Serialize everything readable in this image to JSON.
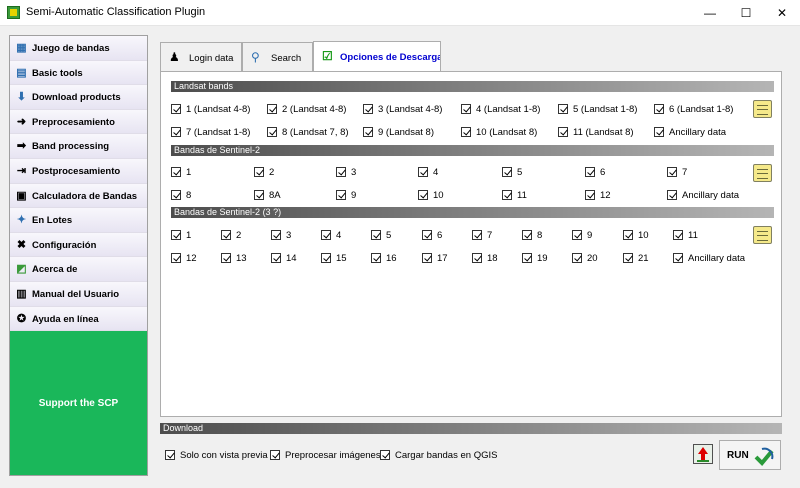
{
  "window": {
    "title": "Semi-Automatic Classification Plugin",
    "minimize": "—",
    "maximize": "☐",
    "close": "✕"
  },
  "sidebar": {
    "items": [
      {
        "label": "Juego de bandas",
        "icon": "band-set-icon"
      },
      {
        "label": "Basic tools",
        "icon": "basic-tools-icon"
      },
      {
        "label": "Download products",
        "icon": "download-icon"
      },
      {
        "label": "Preprocesamiento",
        "icon": "preprocessing-icon"
      },
      {
        "label": "Band processing",
        "icon": "band-processing-icon"
      },
      {
        "label": "Postprocesamiento",
        "icon": "postprocessing-icon"
      },
      {
        "label": "Calculadora de Bandas",
        "icon": "calculator-icon"
      },
      {
        "label": "En Lotes",
        "icon": "batch-icon"
      },
      {
        "label": "Configuración",
        "icon": "settings-icon"
      },
      {
        "label": "Acerca de",
        "icon": "about-icon"
      },
      {
        "label": "Manual del Usuario",
        "icon": "manual-icon"
      },
      {
        "label": "Ayuda en línea",
        "icon": "help-icon"
      }
    ],
    "support": "Support the SCP"
  },
  "tabs": [
    {
      "label": "Login data",
      "icon": "user-icon"
    },
    {
      "label": "Search",
      "icon": "search-icon"
    },
    {
      "label": "Opciones de Descarga",
      "icon": "checkbox-icon"
    }
  ],
  "landsat": {
    "header": "Landsat bands",
    "items": [
      "1 (Landsat 4-8)",
      "2 (Landsat 4-8)",
      "3 (Landsat 4-8)",
      "4 (Landsat 1-8)",
      "5 (Landsat 1-8)",
      "6 (Landsat 1-8)",
      "7 (Landsat 1-8)",
      "8 (Landsat 7, 8)",
      "9 (Landsat 8)",
      "10 (Landsat 8)",
      "11 (Landsat 8)",
      "Ancillary data"
    ]
  },
  "sentinel2": {
    "header": "Bandas de Sentinel-2",
    "items": [
      "1",
      "2",
      "3",
      "4",
      "5",
      "6",
      "7",
      "8",
      "8A",
      "9",
      "10",
      "11",
      "12",
      "Ancillary data"
    ]
  },
  "sentinel3": {
    "header": "Bandas de Sentinel-2 (3 ?)",
    "items": [
      "1",
      "2",
      "3",
      "4",
      "5",
      "6",
      "7",
      "8",
      "9",
      "10",
      "11",
      "12",
      "13",
      "14",
      "15",
      "16",
      "17",
      "18",
      "19",
      "20",
      "21",
      "Ancillary data"
    ]
  },
  "download": {
    "header": "Download",
    "preview_only": "Solo con vista previa",
    "preprocess": "Preprocesar imágenes",
    "load_qgis": "Cargar bandas en QGIS",
    "run": "RUN"
  }
}
